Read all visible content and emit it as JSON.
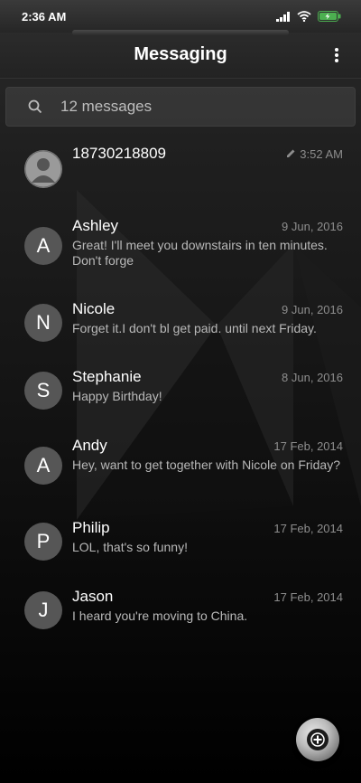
{
  "status": {
    "time": "2:36 AM",
    "icons": [
      "signal-icon",
      "wifi-icon",
      "battery-charging-icon"
    ]
  },
  "header": {
    "title": "Messaging",
    "menu_icon": "more-vert-icon"
  },
  "search": {
    "icon": "search-icon",
    "placeholder": "12 messages"
  },
  "conversations": [
    {
      "avatar": "",
      "avatar_icon": "person-icon",
      "name": "18730218809",
      "date": "3:52 AM",
      "draft": true,
      "preview": ""
    },
    {
      "avatar": "A",
      "name": "Ashley",
      "date": "9 Jun, 2016",
      "preview": "Great! I'll meet you downstairs in ten minutes. Don't forge"
    },
    {
      "avatar": "N",
      "name": "Nicole",
      "date": "9 Jun, 2016",
      "preview": "Forget it.I don't bl get paid. until next Friday."
    },
    {
      "avatar": "S",
      "name": "Stephanie",
      "date": "8 Jun, 2016",
      "preview": "Happy Birthday!"
    },
    {
      "avatar": "A",
      "name": "Andy",
      "date": "17 Feb, 2014",
      "preview": "Hey, want to get together with Nicole on Friday?"
    },
    {
      "avatar": "P",
      "name": "Philip",
      "date": "17 Feb, 2014",
      "preview": "LOL, that's so funny!"
    },
    {
      "avatar": "J",
      "name": "Jason",
      "date": "17 Feb, 2014",
      "preview": "I heard you're moving to China."
    }
  ],
  "fab": {
    "icon": "compose-plus-icon"
  },
  "colors": {
    "avatar_bg": "#565656",
    "date_text": "#8d8d8d",
    "preview_text": "#b9b9b9",
    "battery_accent": "#4caf50"
  }
}
